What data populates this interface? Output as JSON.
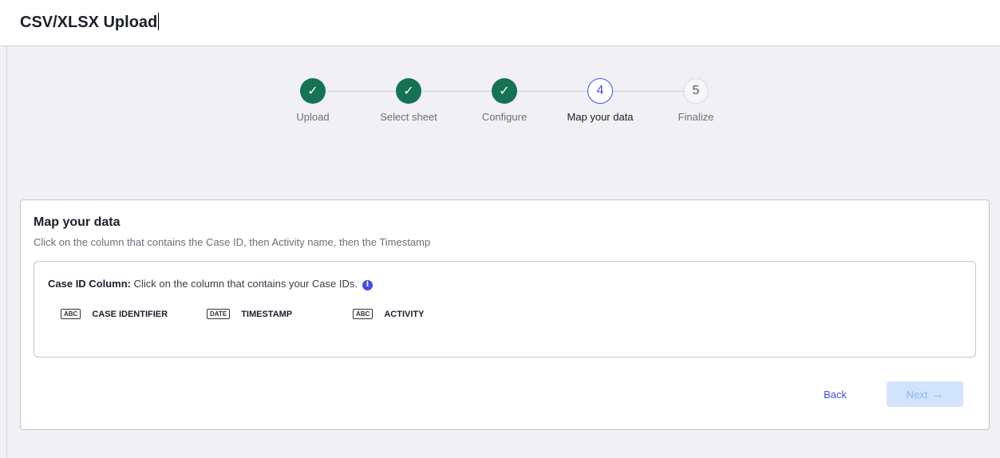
{
  "header": {
    "title": "CSV/XLSX Upload"
  },
  "stepper": {
    "steps": [
      {
        "label": "Upload",
        "state": "done",
        "icon": "check-icon"
      },
      {
        "label": "Select sheet",
        "state": "done",
        "icon": "check-icon"
      },
      {
        "label": "Configure",
        "state": "done",
        "icon": "check-icon"
      },
      {
        "label": "Map your data",
        "state": "active",
        "number": "4"
      },
      {
        "label": "Finalize",
        "state": "todo",
        "number": "5"
      }
    ]
  },
  "card": {
    "title": "Map your data",
    "subtitle": "Click on the column that contains the Case ID, then Activity name, then the Timestamp",
    "instruction_label": "Case ID Column:",
    "instruction_text": " Click on the column that contains your Case IDs.",
    "columns": [
      {
        "type": "ABC",
        "name": "CASE IDENTIFIER"
      },
      {
        "type": "DATE",
        "name": "TIMESTAMP"
      },
      {
        "type": "ABC",
        "name": "ACTIVITY"
      }
    ],
    "back_label": "Back",
    "next_label": "Next"
  },
  "colors": {
    "accent": "#3f4fe8",
    "done": "#157255",
    "next_disabled_bg": "#d2e4fd"
  }
}
